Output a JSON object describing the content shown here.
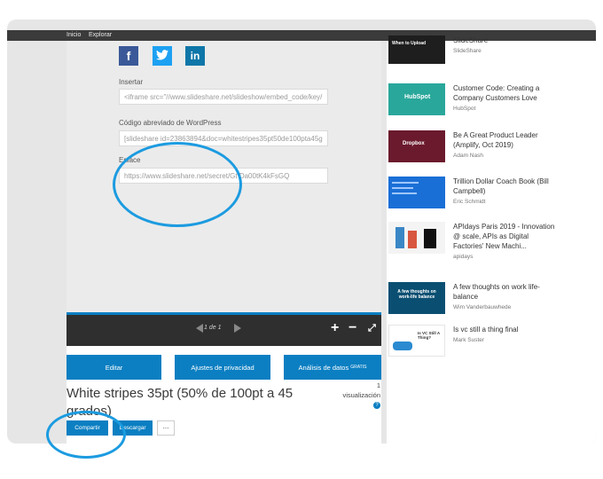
{
  "topnav": {
    "inicio": "Inicio",
    "explorar": "Explorar"
  },
  "social": {
    "facebook": "f",
    "twitter": "🐦",
    "linkedin": "in"
  },
  "embed": {
    "insertar_label": "Insertar",
    "insertar_value": "<iframe src=\"//www.slideshare.net/slideshow/embed_code/key/",
    "wp_label": "Código abreviado de WordPress",
    "wp_value": "[slideshare id=23863894&doc=whitestripes35pt50de100pta45g",
    "enlace_label": "Enlace",
    "enlace_value": "https://www.slideshare.net/secret/Gt Da00tK4kFsGQ"
  },
  "player": {
    "page_indicator": "1 de 1",
    "zoom_in": "+",
    "zoom_out": "−",
    "fullscreen": "⤢"
  },
  "actions": {
    "editar": "Editar",
    "privacidad": "Ajustes de privacidad",
    "analisis": "Análisis de datos",
    "analisis_badge": "GRATIS"
  },
  "presentation": {
    "title": "White stripes 35pt (50% de 100pt a 45 grados)",
    "views_count": "1",
    "views_label": "visualización",
    "help_icon": "?"
  },
  "share": {
    "compartir": "Compartir",
    "descargar": "Descargar",
    "more": "..."
  },
  "sidebar": {
    "items": [
      {
        "title": "SlideShare",
        "author": "SlideShare",
        "thumb_color": "#1e1e1e",
        "thumb_text": "When to Upload"
      },
      {
        "title": "Customer Code: Creating a Company Customers Love",
        "author": "HubSpot",
        "thumb_color": "#2aa79b",
        "thumb_text": "HubSpot"
      },
      {
        "title": "Be A Great Product Leader (Amplify, Oct 2019)",
        "author": "Adam Nash",
        "thumb_color": "#6b1a2d",
        "thumb_text": "Dropbox"
      },
      {
        "title": "Trillion Dollar Coach Book (Bill Campbell)",
        "author": "Eric Schmidt",
        "thumb_color": "#1a6fd6",
        "thumb_text": ""
      },
      {
        "title": "APIdays Paris 2019 - Innovation @ scale, APIs as Digital Factories' New Machi...",
        "author": "apidays",
        "thumb_color": "#f4f4f4",
        "thumb_text": ""
      },
      {
        "title": "A few thoughts on work life-balance",
        "author": "Wim Vanderbauwhede",
        "thumb_color": "#0a4f72",
        "thumb_text": "A few thoughts on work-life balance"
      },
      {
        "title": "Is vc still a thing final",
        "author": "Mark Suster",
        "thumb_color": "#ffffff",
        "thumb_text": "Is VC Still A Thing?"
      }
    ]
  },
  "colors": {
    "accent": "#0b7fc2",
    "annotation": "#1c9be0",
    "topbar": "#3b3b3b",
    "player": "#2f2f2f"
  }
}
